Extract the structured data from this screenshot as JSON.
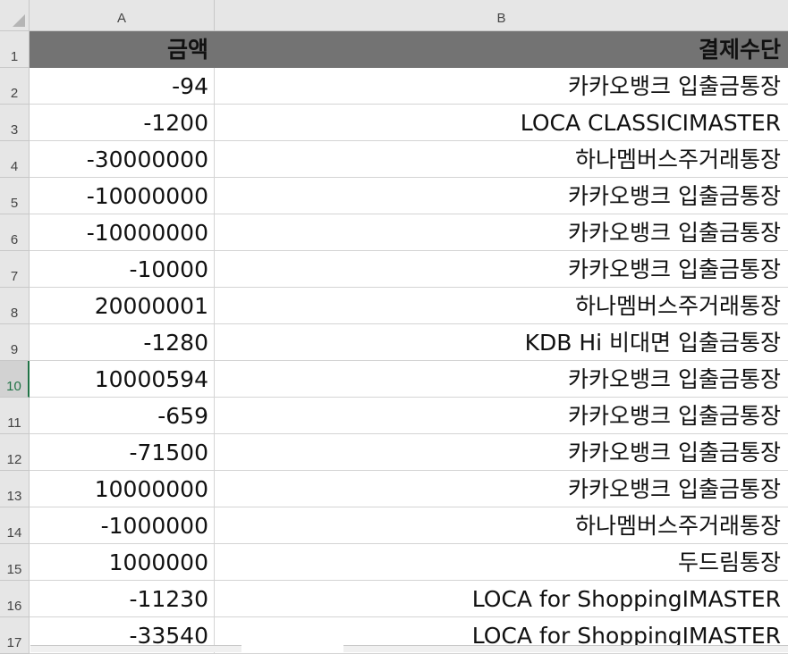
{
  "columns": [
    "A",
    "B"
  ],
  "selected_row": "10",
  "header": {
    "row": "1",
    "amount": "금액",
    "method": "결제수단"
  },
  "rows": [
    {
      "row": "2",
      "amount": "-94",
      "method": "카카오뱅크 입출금통장"
    },
    {
      "row": "3",
      "amount": "-1200",
      "method": "LOCA CLASSICIMASTER"
    },
    {
      "row": "4",
      "amount": "-30000000",
      "method": "하나멤버스주거래통장"
    },
    {
      "row": "5",
      "amount": "-10000000",
      "method": "카카오뱅크 입출금통장"
    },
    {
      "row": "6",
      "amount": "-10000000",
      "method": "카카오뱅크 입출금통장"
    },
    {
      "row": "7",
      "amount": "-10000",
      "method": "카카오뱅크 입출금통장"
    },
    {
      "row": "8",
      "amount": "20000001",
      "method": "하나멤버스주거래통장"
    },
    {
      "row": "9",
      "amount": "-1280",
      "method": "KDB Hi 비대면 입출금통장"
    },
    {
      "row": "10",
      "amount": "10000594",
      "method": "카카오뱅크 입출금통장"
    },
    {
      "row": "11",
      "amount": "-659",
      "method": "카카오뱅크 입출금통장"
    },
    {
      "row": "12",
      "amount": "-71500",
      "method": "카카오뱅크 입출금통장"
    },
    {
      "row": "13",
      "amount": "10000000",
      "method": "카카오뱅크 입출금통장"
    },
    {
      "row": "14",
      "amount": "-1000000",
      "method": "하나멤버스주거래통장"
    },
    {
      "row": "15",
      "amount": "1000000",
      "method": "두드림통장"
    },
    {
      "row": "16",
      "amount": "-11230",
      "method": "LOCA for ShoppingIMASTER"
    },
    {
      "row": "17",
      "amount": "-33540",
      "method": "LOCA for ShoppingIMASTER"
    }
  ]
}
